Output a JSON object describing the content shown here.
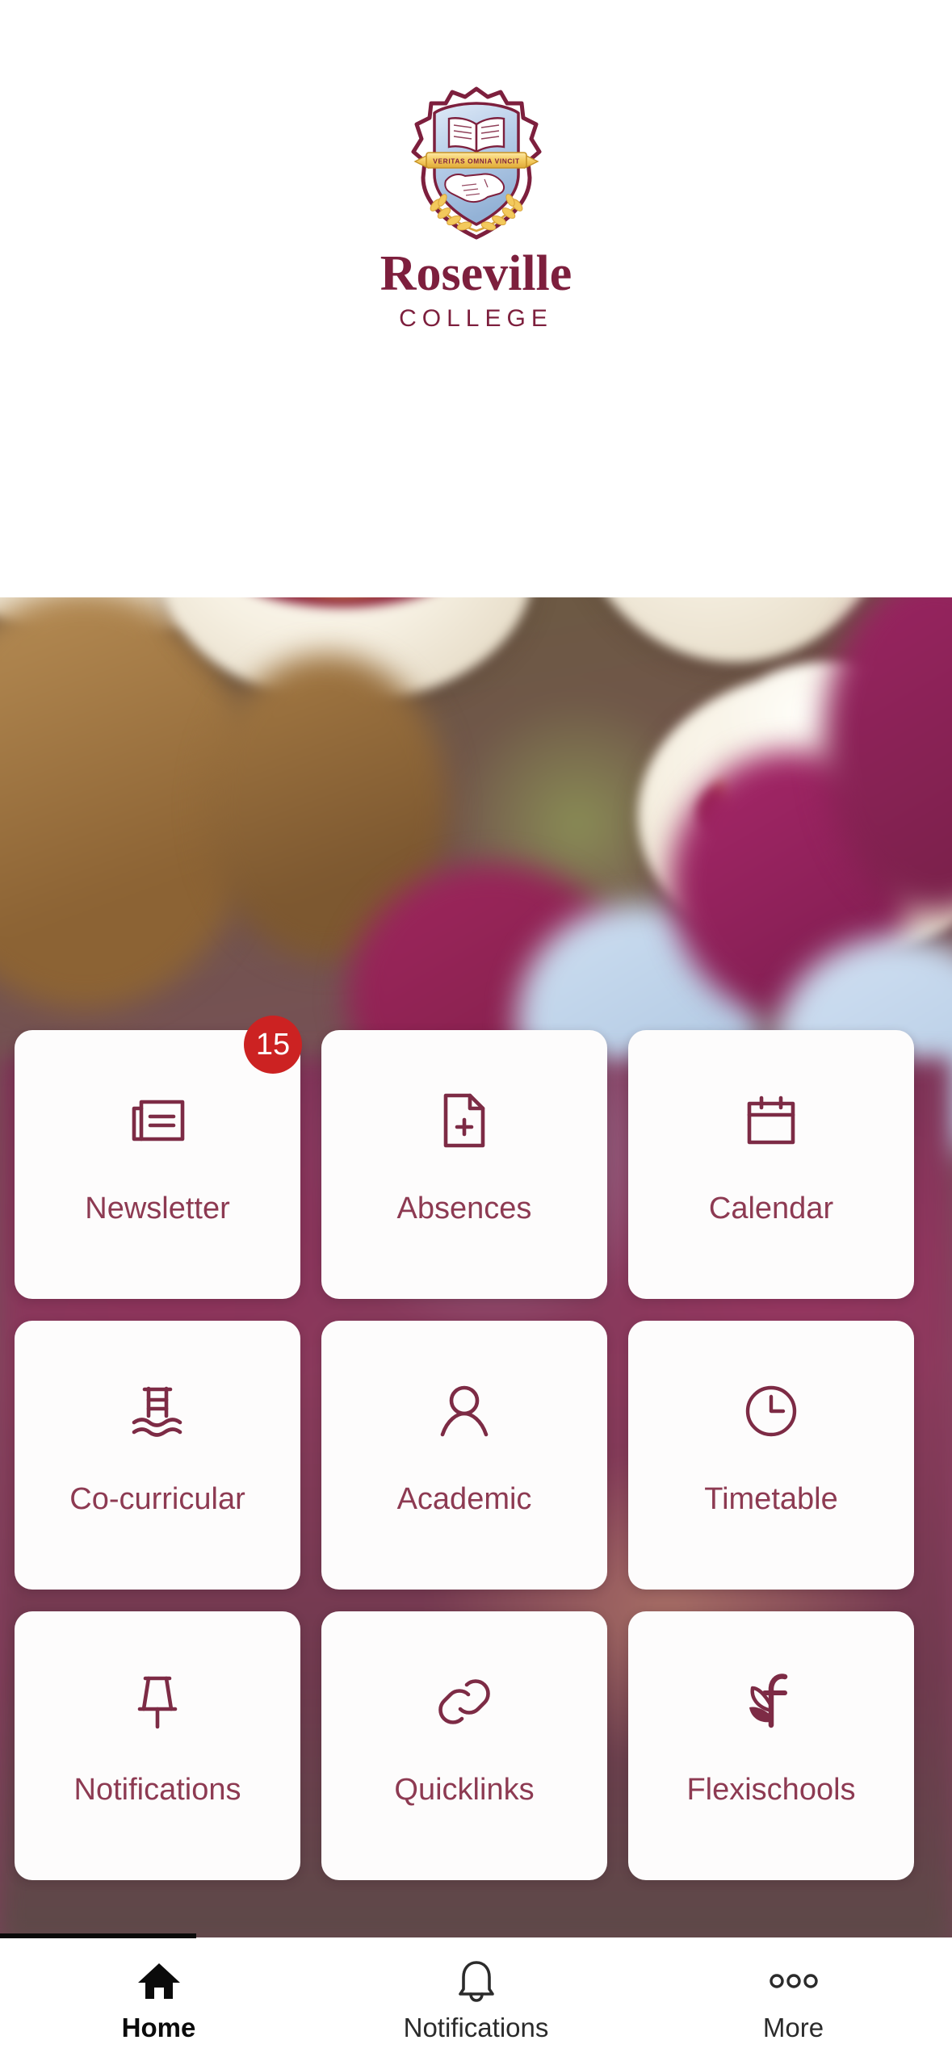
{
  "app": {
    "school_name_line1": "Roseville",
    "school_name_line2": "COLLEGE",
    "crest_motto": "VERITAS OMNIA VINCIT"
  },
  "colors": {
    "brand_maroon": "#7d1f3d",
    "tile_label": "#8d3a52",
    "tile_icon": "#7d2b45",
    "badge_red": "#cc2222",
    "crest_gold": "#f2c75c",
    "crest_shield_blue": "#b9cfe8",
    "tile_bg": "#fdfcfc",
    "nav_active": "#0b0b0b",
    "nav_inactive": "#2b2b2b"
  },
  "tiles": [
    {
      "label": "Newsletter",
      "icon": "newspaper-icon",
      "badge": "15"
    },
    {
      "label": "Absences",
      "icon": "document-plus-icon",
      "badge": ""
    },
    {
      "label": "Calendar",
      "icon": "calendar-icon",
      "badge": ""
    },
    {
      "label": "Co-curricular",
      "icon": "pool-ladder-icon",
      "badge": ""
    },
    {
      "label": "Academic",
      "icon": "person-icon",
      "badge": ""
    },
    {
      "label": "Timetable",
      "icon": "clock-icon",
      "badge": ""
    },
    {
      "label": "Notifications",
      "icon": "pushpin-icon",
      "badge": ""
    },
    {
      "label": "Quicklinks",
      "icon": "chain-link-icon",
      "badge": ""
    },
    {
      "label": "Flexischools",
      "icon": "flexischools-f-icon",
      "badge": ""
    }
  ],
  "bottom_nav": [
    {
      "label": "Home",
      "icon": "home-icon",
      "active": true
    },
    {
      "label": "Notifications",
      "icon": "bell-icon",
      "active": false
    },
    {
      "label": "More",
      "icon": "more-dots-icon",
      "active": false
    }
  ]
}
